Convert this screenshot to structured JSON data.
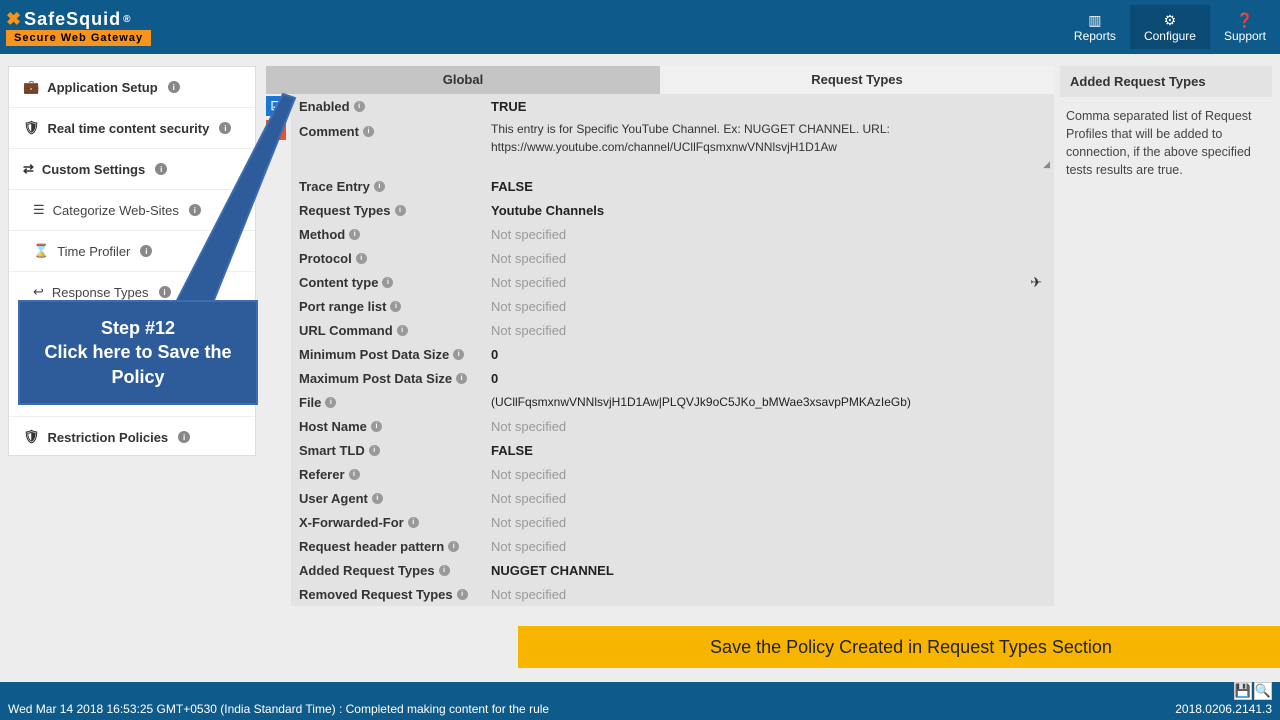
{
  "header": {
    "logo_text": "SafeSquid",
    "logo_sub": "Secure Web Gateway",
    "actions": {
      "reports": "Reports",
      "configure": "Configure",
      "support": "Support"
    }
  },
  "sidebar": {
    "app_setup": "Application Setup",
    "realtime": "Real time content security",
    "custom": "Custom Settings",
    "categorize": "Categorize Web-Sites",
    "time": "Time Profiler",
    "response": "Response Types",
    "restriction": "Restriction Policies"
  },
  "tabs": {
    "global": "Global",
    "reqtypes": "Request Types"
  },
  "form": {
    "enabled": {
      "label": "Enabled",
      "value": "TRUE"
    },
    "comment": {
      "label": "Comment",
      "value": "This entry is for Specific YouTube Channel.  Ex: NUGGET CHANNEL.   URL: https://www.youtube.com/channel/UCllFqsmxnwVNNlsvjH1D1Aw"
    },
    "trace": {
      "label": "Trace Entry",
      "value": "FALSE"
    },
    "reqtypes": {
      "label": "Request Types",
      "value": "Youtube Channels"
    },
    "method": {
      "label": "Method",
      "value": "Not specified"
    },
    "protocol": {
      "label": "Protocol",
      "value": "Not specified"
    },
    "ctype": {
      "label": "Content type",
      "value": "Not specified"
    },
    "port": {
      "label": "Port range list",
      "value": "Not specified"
    },
    "urlcmd": {
      "label": "URL Command",
      "value": "Not specified"
    },
    "minpost": {
      "label": "Minimum Post Data Size",
      "value": "0"
    },
    "maxpost": {
      "label": "Maximum Post Data Size",
      "value": "0"
    },
    "file": {
      "label": "File",
      "value": "(UCllFqsmxnwVNNlsvjH1D1Aw|PLQVJk9oC5JKo_bMWae3xsavpPMKAzIeGb)"
    },
    "host": {
      "label": "Host Name",
      "value": "Not specified"
    },
    "tld": {
      "label": "Smart TLD",
      "value": "FALSE"
    },
    "referer": {
      "label": "Referer",
      "value": "Not specified"
    },
    "ua": {
      "label": "User Agent",
      "value": "Not specified"
    },
    "xff": {
      "label": "X-Forwarded-For",
      "value": "Not specified"
    },
    "reqhdr": {
      "label": "Request header pattern",
      "value": "Not specified"
    },
    "added": {
      "label": "Added Request Types",
      "value": "NUGGET CHANNEL"
    },
    "removed": {
      "label": "Removed Request Types",
      "value": "Not specified"
    }
  },
  "help": {
    "title": "Added Request Types",
    "body": "Comma separated list of Request Profiles that will be added to connection, if the above specified tests results are true."
  },
  "banner": "Save the Policy Created in Request Types Section",
  "callout": {
    "title": "Step #12",
    "line": "Click here to Save the Policy"
  },
  "footer": {
    "status": "Wed Mar 14 2018 16:53:25 GMT+0530 (India Standard Time) : Completed making content for the rule",
    "version": "2018.0206.2141.3"
  }
}
